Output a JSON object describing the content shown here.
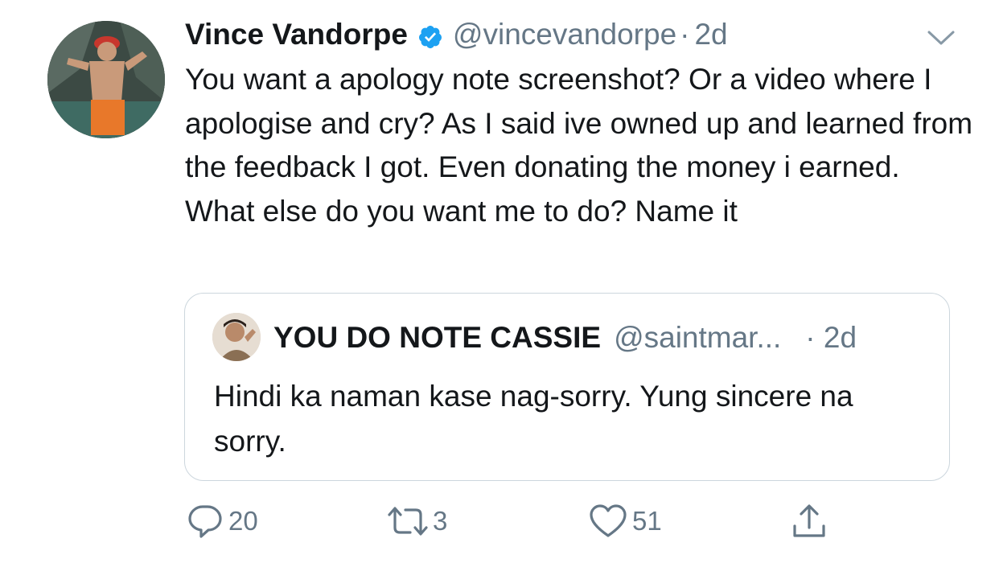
{
  "tweet": {
    "author_name": "Vince Vandorpe",
    "handle": "@vincevandorpe",
    "separator": "·",
    "time": "2d",
    "text": "You want a apology note screenshot? Or a video where I apologise and cry? As I said ive owned up and learned from the feedback I got. Even donating the money i earned. What else do you want me to do? Name it",
    "verified": true
  },
  "quoted_tweet": {
    "author_name": "YOU DO NOTE CASSIE",
    "handle": "@saintmar...",
    "time": "· 2d",
    "text": "Hindi ka naman kase nag-sorry. Yung sincere na sorry."
  },
  "actions": {
    "replies": "20",
    "retweets": "3",
    "likes": "51"
  },
  "icons": {
    "verified": "verified-badge-icon",
    "caret": "chevron-down-icon",
    "reply": "reply-icon",
    "retweet": "retweet-icon",
    "like": "heart-icon",
    "share": "share-icon"
  },
  "colors": {
    "text": "#14171a",
    "secondary": "#657786",
    "verified_blue": "#1da1f2",
    "border": "#ccd6dd"
  }
}
